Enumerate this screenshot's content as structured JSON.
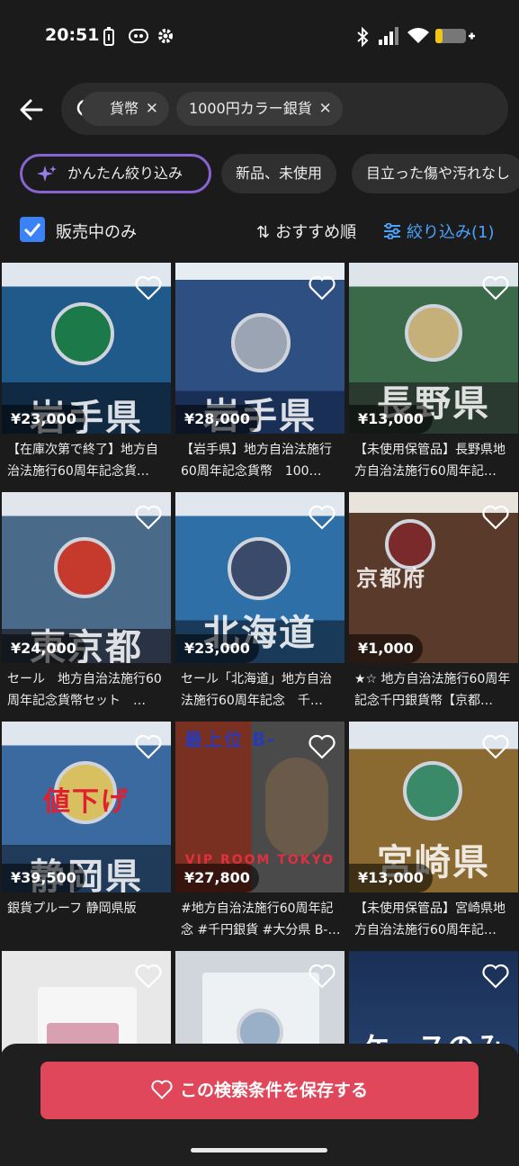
{
  "status_bar": {
    "time": "20:51",
    "icons": [
      "battery-saver-icon",
      "assistant-icon",
      "settings-icon",
      "bluetooth-icon",
      "signal-icon",
      "wifi-icon",
      "battery-icon"
    ]
  },
  "search": {
    "partial_tag": "貨幣",
    "tag": "1000円カラー銀貨",
    "remove_symbol": "✕"
  },
  "filters": {
    "ai_filter": "かんたん絞り込み",
    "chips": [
      "新品、未使用",
      "目立った傷や汚れなし"
    ]
  },
  "options": {
    "on_sale_only": "販売中のみ",
    "on_sale_checked": true,
    "sort": "おすすめ順",
    "filter": "絞り込み(1)"
  },
  "items": [
    {
      "price": "¥23,000",
      "title": "【在庫次第で終了】地方自治法施行60周年記念貨…",
      "label": "岩手県",
      "coin_color": "#1c7a4a",
      "bg": "#1f5a8a"
    },
    {
      "price": "¥28,000",
      "title": "【岩手県】地方自治法施行60周年記念貨幣　100…",
      "label": "岩手県",
      "coin_color": "#9aa4b2",
      "bg": "#2e4f82"
    },
    {
      "price": "¥13,000",
      "title": "【未使用保管品】長野県地方自治法施行60周年記…",
      "label": "長野県",
      "coin_color": "#c6b07a",
      "bg": "#3b6a4a"
    },
    {
      "price": "¥24,000",
      "title": "セール　地方自治法施行60周年記念貨幣セット　…",
      "label": "東京都",
      "coin_color": "#c63a2e",
      "bg": "#4a6a8a"
    },
    {
      "price": "¥23,000",
      "title": "セール「北海道」地方自治法施行60周年記念　千…",
      "label": "北海道",
      "coin_color": "#3a4a6a",
      "bg": "#2f6fa8"
    },
    {
      "price": "¥1,000",
      "title": "★☆ 地方自治法施行60周年記念千円銀貨幣【京都…",
      "label": "京都府",
      "coin_color": "#7a2a2a",
      "bg": "#5a3a2a"
    },
    {
      "price": "¥39,500",
      "title": "銀貨プルーフ 静岡県版",
      "label": "静岡県",
      "coin_color": "#d8c060",
      "bg": "#3a6aa0"
    },
    {
      "price": "¥27,800",
      "title": "#地方自治法施行60周年記念 #千円銀貨 #大分県 B-…",
      "label": "VIP ROOM TOKYO",
      "coin_color": "#c0c0c0",
      "bg": "#7a3020"
    },
    {
      "price": "¥13,000",
      "title": "【未使用保管品】宮崎県地方自治法施行60周年記…",
      "label": "宮崎県",
      "coin_color": "#3a8a6a",
      "bg": "#8a6a30"
    },
    {
      "price": "",
      "title": "",
      "label": "",
      "coin_color": "#d8a0b0",
      "bg": "#e8e8e8"
    },
    {
      "price": "",
      "title": "",
      "label": "",
      "coin_color": "#9ab0c8",
      "bg": "#d0d6dc"
    },
    {
      "price": "",
      "title": "",
      "label": "ケースのみ",
      "coin_color": "#2a4a7a",
      "bg": "#2a4a7a"
    }
  ],
  "overlay_text": {
    "item7_banner": "値下げ",
    "item8_banner": "最上位 B-"
  },
  "save_search": {
    "label": "この検索条件を保存する"
  },
  "colors": {
    "accent_blue": "#4aa3ff",
    "save_red": "#e0475a",
    "checkbox_blue": "#3b82f6"
  }
}
